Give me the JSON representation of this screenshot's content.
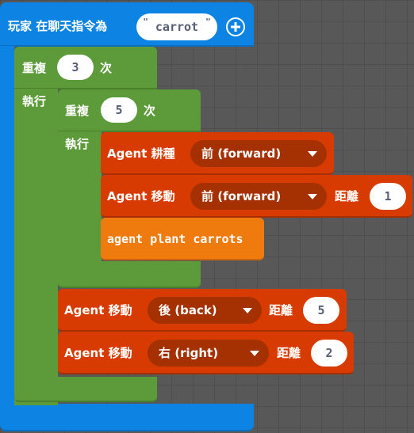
{
  "event_block": {
    "label": "玩家 在聊天指令為",
    "command_value": "carrot",
    "quote_open": "\"",
    "quote_close": "\""
  },
  "outer_repeat": {
    "label_repeat": "重複",
    "count": "3",
    "label_times": "次",
    "label_do": "執行"
  },
  "inner_repeat": {
    "label_repeat": "重複",
    "count": "5",
    "label_times": "次",
    "label_do": "執行"
  },
  "till_block": {
    "label": "Agent 耕種",
    "direction": "前 (forward)"
  },
  "move_forward_block": {
    "label": "Agent 移動",
    "direction": "前 (forward)",
    "distance_label": "距離",
    "distance": "1"
  },
  "plant_block": {
    "label": "agent plant carrots"
  },
  "move_back_block": {
    "label": "Agent 移動",
    "direction": "後 (back)",
    "distance_label": "距離",
    "distance": "5"
  },
  "move_right_block": {
    "label": "Agent 移動",
    "direction": "右 (right)",
    "distance_label": "距離",
    "distance": "2"
  },
  "colors": {
    "workspace": "#585858",
    "event_blue": "#0d84e3",
    "loop_green": "#5d9b3a",
    "agent_red": "#d83b01",
    "function_orange": "#ef7b0f"
  }
}
